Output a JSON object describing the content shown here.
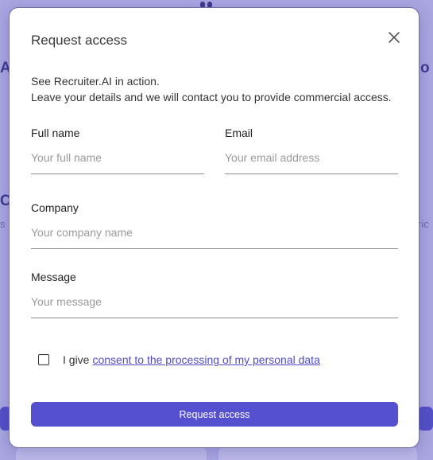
{
  "background": {
    "frag_left_top": "A",
    "frag_right_top": "o",
    "frag_left_mid": "C",
    "frag_left_small": "s l",
    "frag_right_small": "ric"
  },
  "modal": {
    "title": "Request access",
    "close_icon": "close-icon",
    "intro_line_1": "See Recruiter.AI in action.",
    "intro_line_2": "Leave your details and we will contact you to provide commercial access."
  },
  "form": {
    "full_name": {
      "label": "Full name",
      "placeholder": "Your full name",
      "value": ""
    },
    "email": {
      "label": "Email",
      "placeholder": "Your email address",
      "value": ""
    },
    "company": {
      "label": "Company",
      "placeholder": "Your company name",
      "value": ""
    },
    "message": {
      "label": "Message",
      "placeholder": "Your message",
      "value": ""
    },
    "consent": {
      "checked": false,
      "prefix": "I give",
      "link_text": "consent to the processing of my personal data"
    },
    "submit_label": "Request access"
  },
  "colors": {
    "accent": "#5450d0",
    "link": "#4f4cc6",
    "backdrop": "#a9a6e2"
  }
}
